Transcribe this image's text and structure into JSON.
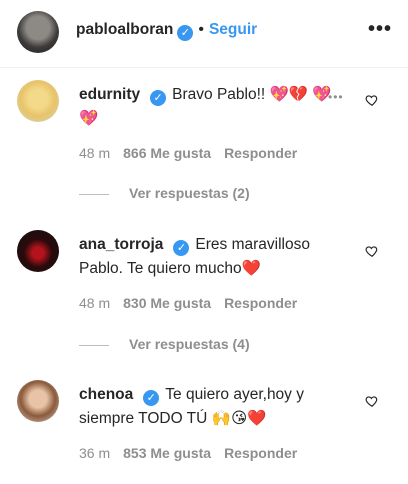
{
  "post": {
    "author": "pablolaboran",
    "author_display": "pabloalboran",
    "separator": "•",
    "follow_label": "Seguir",
    "more_label": "•••"
  },
  "comments": [
    {
      "username": "edurnity",
      "text": "Bravo Pablo!! 💖💔 💖💖",
      "time": "48 m",
      "likes": "866 Me gusta",
      "reply_label": "Responder",
      "view_replies": "Ver respuestas (2)",
      "extra": "•••"
    },
    {
      "username": "ana_torroja",
      "text": "Eres maravilloso Pablo. Te quiero mucho❤️",
      "time": "48 m",
      "likes": "830 Me gusta",
      "reply_label": "Responder",
      "view_replies": "Ver respuestas (4)"
    },
    {
      "username": "chenoa",
      "text": "Te quiero ayer,hoy y siempre TODO TÚ 🙌😘❤️",
      "time": "36 m",
      "likes": "853 Me gusta",
      "reply_label": "Responder"
    }
  ],
  "colors": {
    "accent": "#3897f0",
    "muted": "#8e8e8e",
    "text": "#262626",
    "heart": "#e0245e"
  }
}
